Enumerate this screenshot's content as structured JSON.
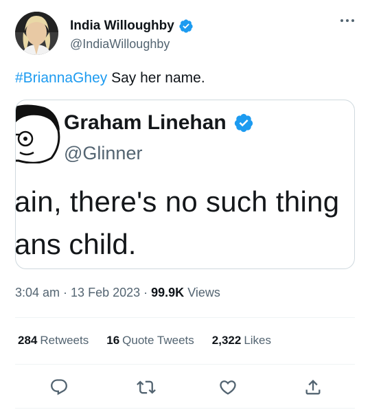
{
  "author": {
    "display_name": "India Willoughby",
    "handle": "@IndiaWilloughby",
    "avatar_icon": "profile-photo",
    "verified_icon": "verified-badge-icon"
  },
  "tweet": {
    "hashtag": "#BriannaGhey",
    "text": " Say her name."
  },
  "quoted": {
    "display_name": "Graham Linehan",
    "handle": "@Glinner",
    "line1": "ain, there's no such thing",
    "line2": "ans child."
  },
  "meta": {
    "time": "3:04 am",
    "sep1": " · ",
    "date": "13 Feb 2023",
    "sep2": " · ",
    "views_count": "99.9K",
    "views_label": " Views"
  },
  "stats": {
    "retweets_count": "284",
    "retweets_label": "Retweets",
    "quotes_count": "16",
    "quotes_label": "Quote Tweets",
    "likes_count": "2,322",
    "likes_label": "Likes"
  },
  "actions": [
    "reply-icon",
    "retweet-icon",
    "like-icon",
    "share-icon"
  ],
  "colors": {
    "accent": "#1d9bf0",
    "text": "#0f1419",
    "secondary": "#536471",
    "border": "#cfd9de"
  }
}
